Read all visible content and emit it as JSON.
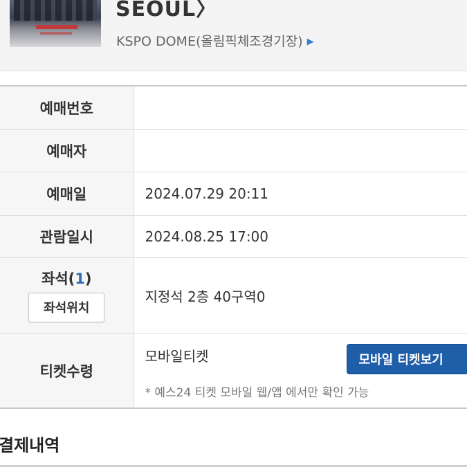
{
  "show": {
    "title": "SEOUL〉",
    "venue": "KSPO DOME(올림픽체조경기장)",
    "venue_arrow": "▶"
  },
  "reservation": {
    "booking_number": {
      "label": "예매번호",
      "value": ""
    },
    "booker": {
      "label": "예매자",
      "value": ""
    },
    "booking_date": {
      "label": "예매일",
      "value": "2024.07.29 20:11"
    },
    "show_datetime": {
      "label": "관람일시",
      "value": "2024.08.25 17:00"
    },
    "seat": {
      "label": "좌석",
      "paren_open": "(",
      "count": "1",
      "paren_close": ")",
      "location_button": "좌석위치",
      "value": "지정석 2층 40구역0"
    },
    "ticket": {
      "label": "티켓수령",
      "type": "모바일티켓",
      "mobile_button": "모바일 티켓보기",
      "note": "* 예스24 티켓 모바일 웹/앱 에서만 확인 가능"
    }
  },
  "payment": {
    "title": "결제내역"
  },
  "colors": {
    "accent_blue": "#1f5ea9",
    "count_blue": "#2c6db6",
    "header_bg": "#f4f4f4"
  }
}
